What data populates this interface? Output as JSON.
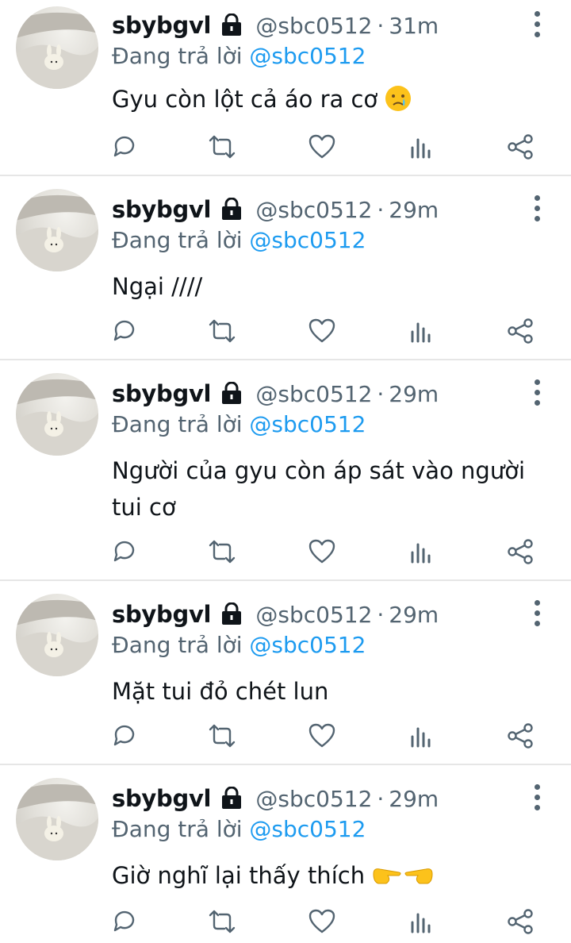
{
  "tweets": [
    {
      "name": "sbybgvl",
      "handle": "@sbc0512",
      "separator": "·",
      "time": "31m",
      "reply_prefix": "Đang trả lời",
      "reply_to": "@sbc0512",
      "text": "Gyu còn lột cả áo ra cơ",
      "emoji": "crying-face"
    },
    {
      "name": "sbybgvl",
      "handle": "@sbc0512",
      "separator": "·",
      "time": "29m",
      "reply_prefix": "Đang trả lời",
      "reply_to": "@sbc0512",
      "text": "Ngại ////"
    },
    {
      "name": "sbybgvl",
      "handle": "@sbc0512",
      "separator": "·",
      "time": "29m",
      "reply_prefix": "Đang trả lời",
      "reply_to": "@sbc0512",
      "text": "Người của gyu còn áp sát vào người tui cơ"
    },
    {
      "name": "sbybgvl",
      "handle": "@sbc0512",
      "separator": "·",
      "time": "29m",
      "reply_prefix": "Đang trả lời",
      "reply_to": "@sbc0512",
      "text": "Mặt tui đỏ chét lun"
    },
    {
      "name": "sbybgvl",
      "handle": "@sbc0512",
      "separator": "·",
      "time": "29m",
      "reply_prefix": "Đang trả lời",
      "reply_to": "@sbc0512",
      "text": "Giờ nghĩ lại thấy thích",
      "emoji": "pointing-fingers-together"
    }
  ],
  "icons": {
    "lock": "lock-icon",
    "more": "more-vertical-icon",
    "reply": "reply-icon",
    "retweet": "retweet-icon",
    "like": "heart-icon",
    "views": "views-chart-icon",
    "share": "share-icon"
  },
  "colors": {
    "text": "#0f1419",
    "secondary": "#536471",
    "mention": "#1d9bf0",
    "divider": "#e6e6e6"
  }
}
